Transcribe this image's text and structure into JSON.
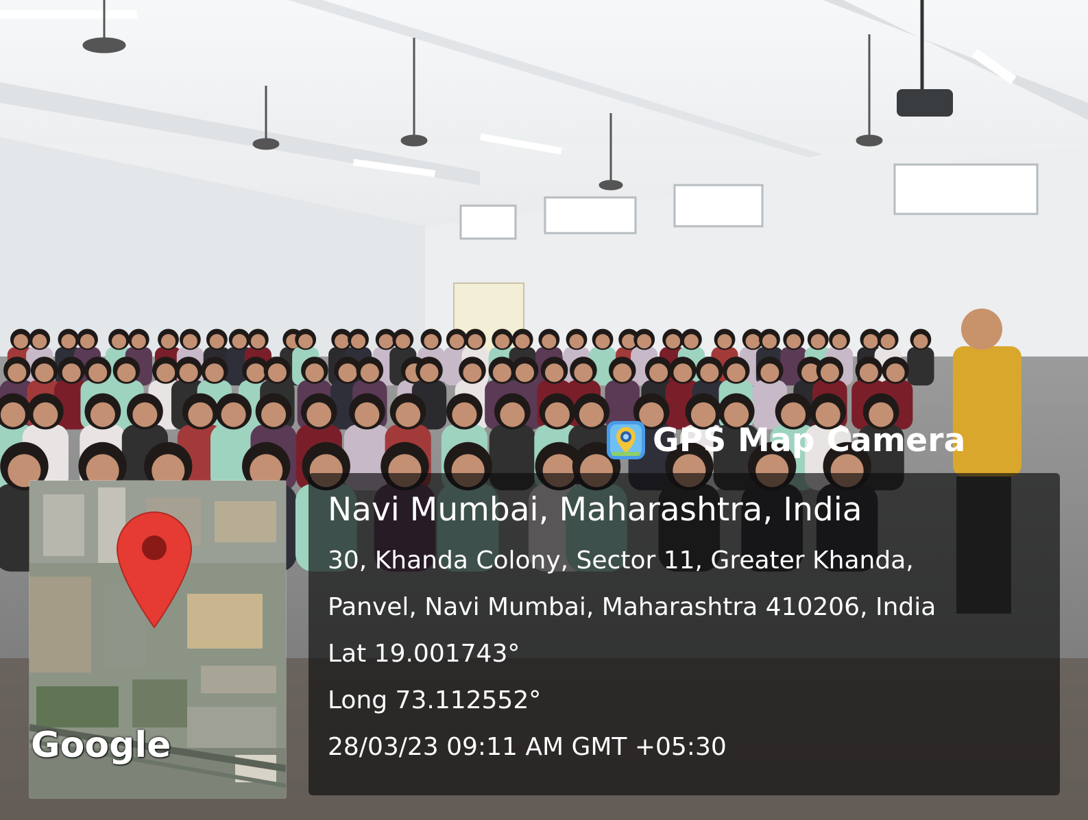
{
  "overlay": {
    "brand": {
      "label": "GPS Map Camera",
      "icon": "gps-camera-pin-icon"
    },
    "location_title": "Navi Mumbai, Maharashtra, India",
    "address_line1": "30, Khanda Colony, Sector 11, Greater Khanda,",
    "address_line2": "Panvel, Navi Mumbai, Maharashtra 410206, India",
    "latitude": "Lat 19.001743°",
    "longitude": "Long 73.112552°",
    "timestamp": "28/03/23 09:11 AM GMT +05:30",
    "map": {
      "attribution": "Google",
      "marker_icon": "map-pin-icon",
      "marker_color": "#e53b33"
    }
  },
  "colors": {
    "panel_bg": "#0c0c0e",
    "text": "#ffffff",
    "wall": "#e9ecee",
    "ceiling": "#f3f4f5"
  }
}
